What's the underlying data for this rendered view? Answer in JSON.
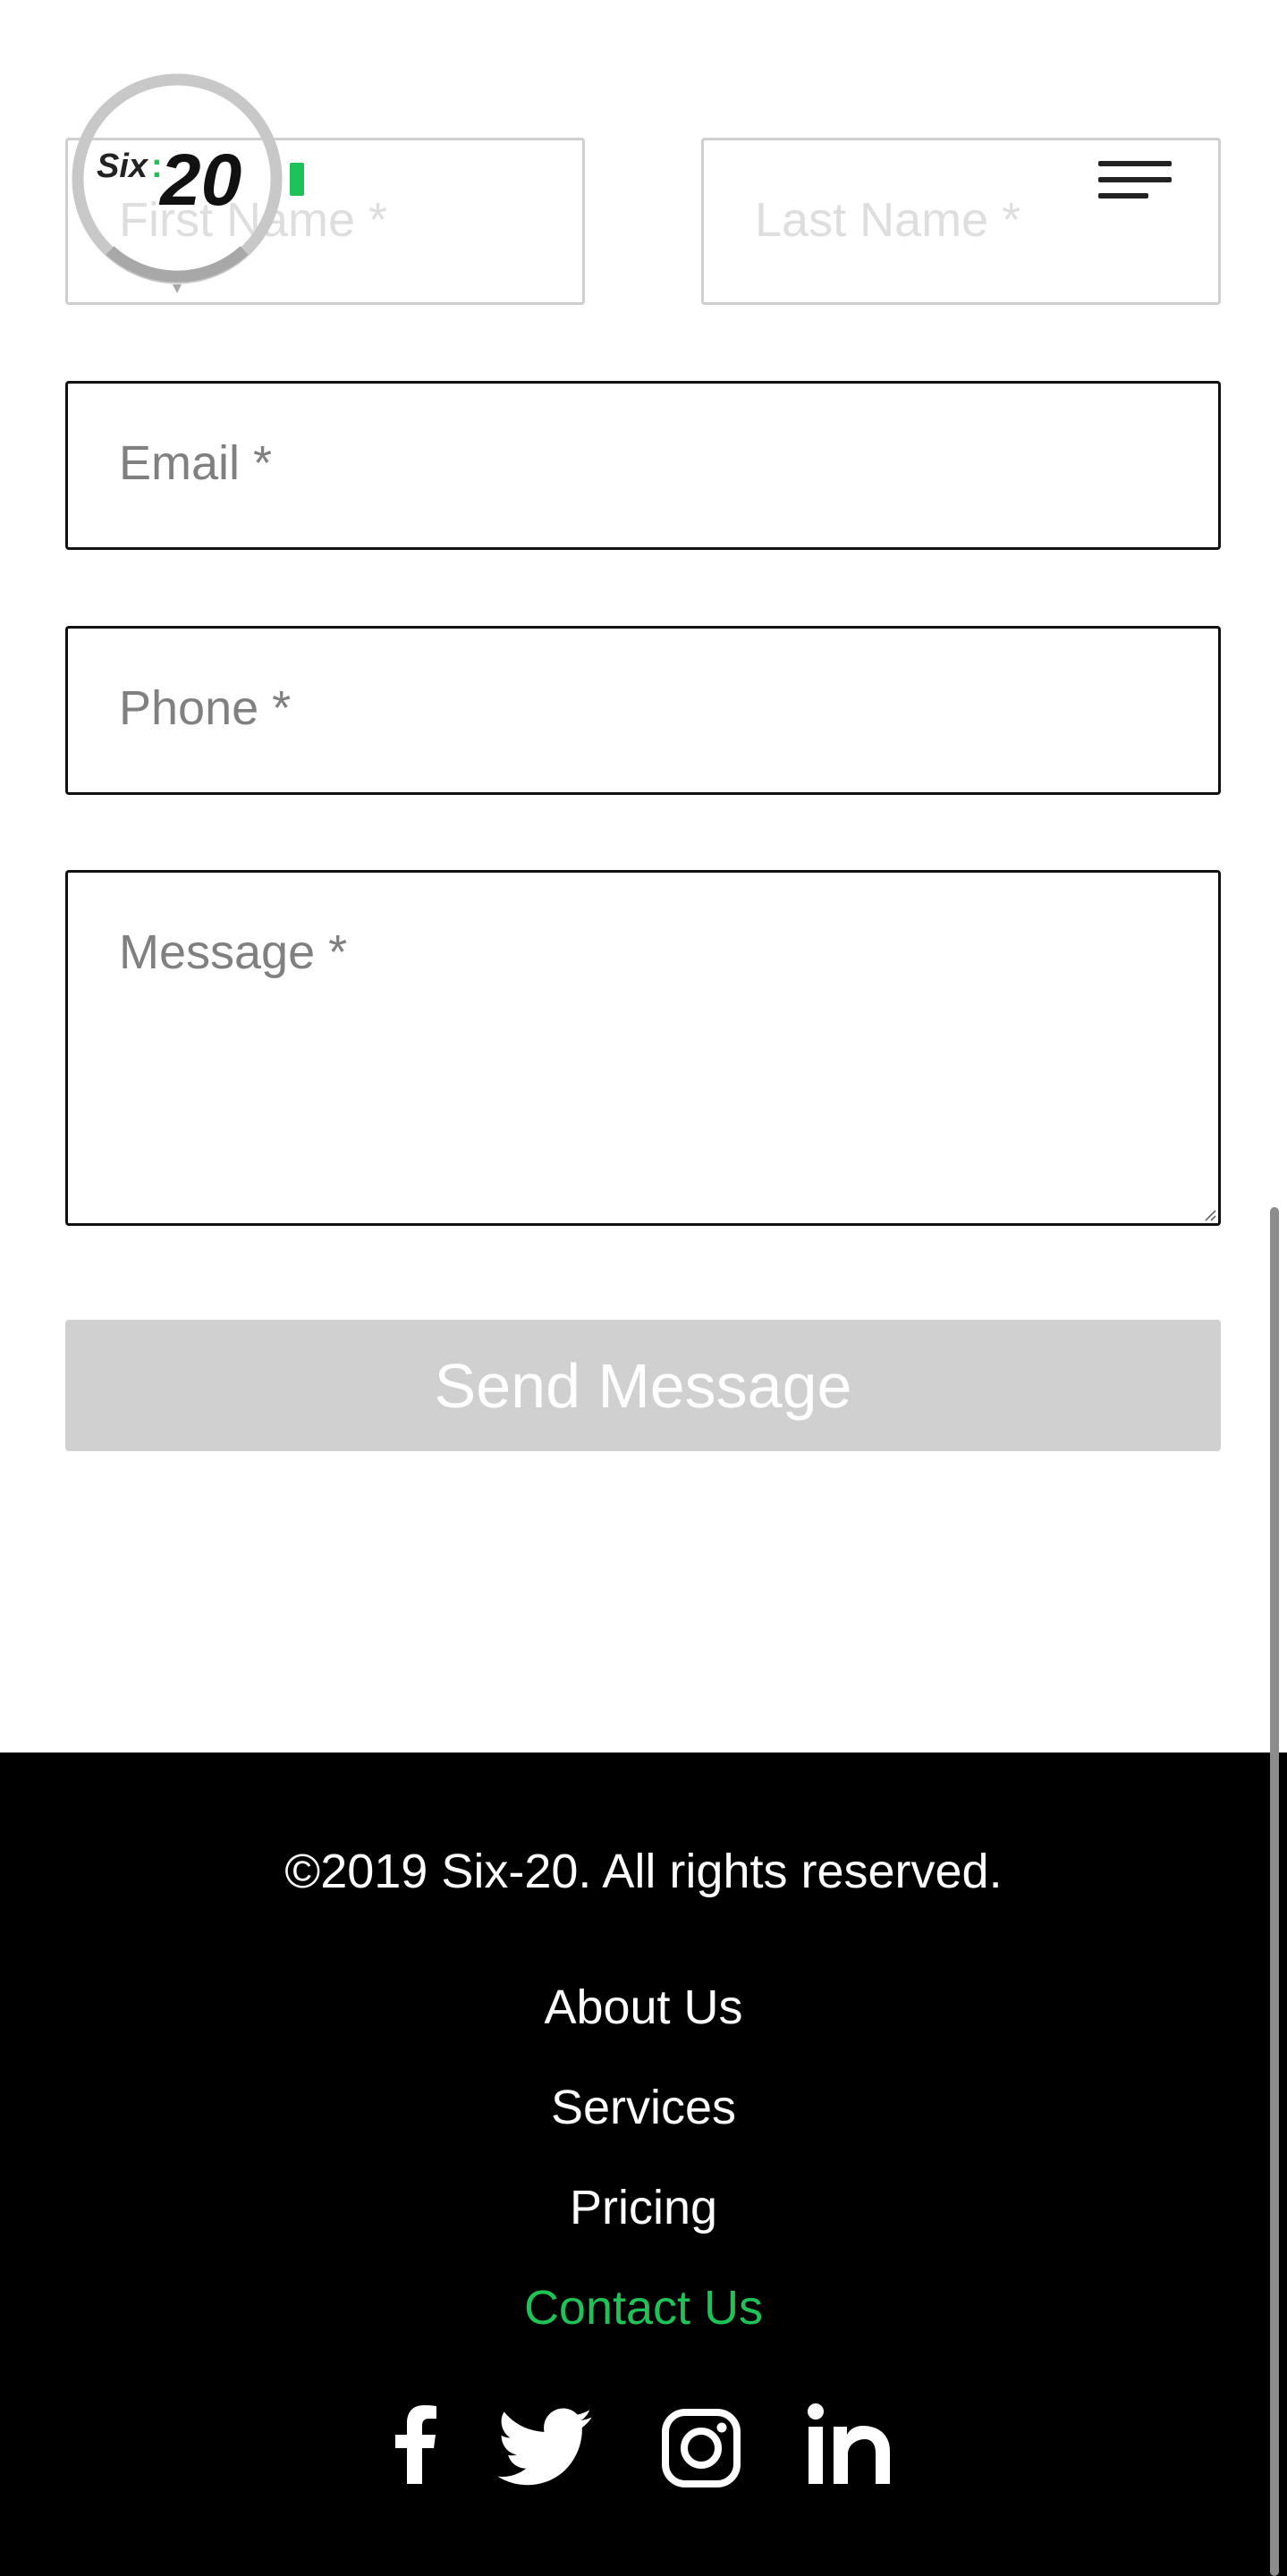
{
  "form": {
    "first_name_placeholder": "First Name *",
    "last_name_placeholder": "Last Name *",
    "email_placeholder": "Email *",
    "phone_placeholder": "Phone *",
    "message_placeholder": "Message *",
    "send_label": "Send Message"
  },
  "header": {
    "logo_text": "Six:20",
    "menu_icon": "hamburger-menu-icon"
  },
  "footer": {
    "copyright": "©2019 Six-20. All rights reserved.",
    "links": [
      "About Us",
      "Services",
      "Pricing",
      "Contact Us"
    ],
    "active_link": "Contact Us",
    "social_icons": [
      "facebook-icon",
      "twitter-icon",
      "instagram-icon",
      "linkedin-icon"
    ]
  },
  "colors": {
    "accent": "#1fc256",
    "footer_bg": "#000000",
    "button_bg": "#d0d0d0"
  }
}
